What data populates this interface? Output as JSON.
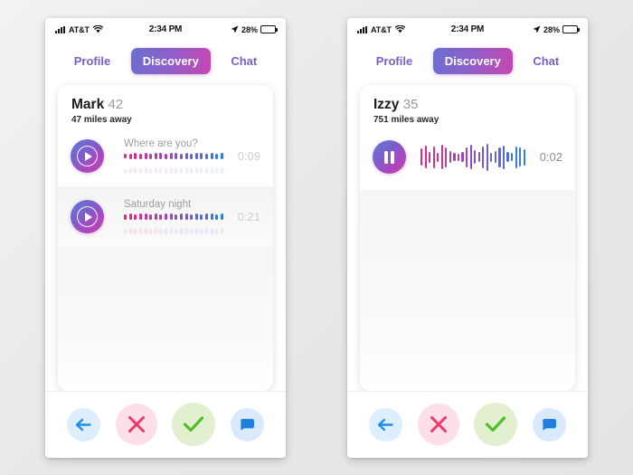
{
  "meta": {
    "background_color": "#ebebeb",
    "accent_gradient_start": "#6b6fd0",
    "accent_gradient_end": "#c547b0"
  },
  "status_bar": {
    "carrier": "AT&T",
    "time": "2:34 PM",
    "battery_percent": "28%",
    "signal_icon": "cellular-signal-icon",
    "wifi_icon": "wifi-icon",
    "location_icon": "location-arrow-icon",
    "battery_icon": "battery-icon"
  },
  "tabs": [
    {
      "label": "Profile",
      "name": "tab-profile",
      "active": false
    },
    {
      "label": "Discovery",
      "name": "tab-discovery",
      "active": true
    },
    {
      "label": "Chat",
      "name": "tab-chat",
      "active": false
    }
  ],
  "action_bar": [
    {
      "name": "rewind-button",
      "icon": "back-arrow-icon",
      "color": "#1f8fe8",
      "bg": "#dceeff",
      "label": "Rewind"
    },
    {
      "name": "reject-button",
      "icon": "close-x-icon",
      "color": "#f0376b",
      "bg": "#fddfe8",
      "label": "Pass"
    },
    {
      "name": "like-button",
      "icon": "check-icon",
      "color": "#4fbe28",
      "bg": "#e3f0cf",
      "label": "Like"
    },
    {
      "name": "message-button",
      "icon": "chat-bubble-icon",
      "color": "#1f7fe0",
      "bg": "#d9eaff",
      "label": "Message"
    }
  ],
  "phones": [
    {
      "id": "phone-left",
      "profile": {
        "name": "Mark",
        "age": "42",
        "distance": "47 miles away"
      },
      "audio_clips": [
        {
          "name": "audio-clip-where-are-you",
          "title": "Where are you?",
          "duration": "0:09",
          "state": "paused",
          "button_icon": "play-icon",
          "waveform_style": "dots",
          "heights": [
            6,
            7,
            8,
            7,
            8,
            7,
            8,
            8,
            7,
            8,
            8,
            7,
            8,
            7,
            8,
            8,
            7,
            8,
            7,
            8
          ]
        },
        {
          "name": "audio-clip-saturday-night",
          "title": "Saturday night",
          "duration": "0:21",
          "state": "paused",
          "button_icon": "play-icon",
          "waveform_style": "dots",
          "heights": [
            7,
            8,
            7,
            8,
            8,
            7,
            8,
            7,
            8,
            8,
            7,
            8,
            8,
            7,
            8,
            7,
            8,
            8,
            7,
            8
          ]
        }
      ]
    },
    {
      "id": "phone-right",
      "profile": {
        "name": "Izzy",
        "age": "35",
        "distance": "751 miles away"
      },
      "audio_clips": [
        {
          "name": "audio-clip-izzy-playing",
          "title": "",
          "duration": "0:02",
          "state": "playing",
          "button_icon": "pause-icon",
          "waveform_style": "bars",
          "heights": [
            19,
            25,
            12,
            24,
            10,
            27,
            22,
            13,
            9,
            8,
            11,
            22,
            27,
            15,
            11,
            24,
            30,
            10,
            13,
            22,
            26,
            11,
            9,
            24,
            21,
            18
          ]
        }
      ]
    }
  ]
}
